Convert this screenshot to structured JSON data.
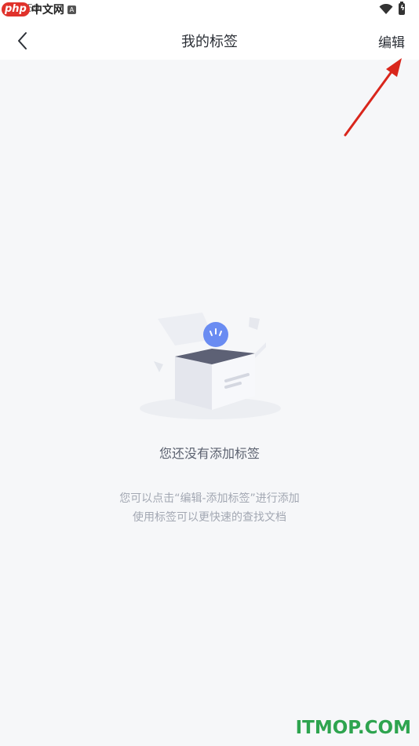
{
  "status_bar": {
    "time": ":59",
    "watermark_logo": "php",
    "watermark_text": "中文网",
    "notif_icon_letter": "A",
    "icons": [
      "wifi-icon",
      "battery-icon"
    ]
  },
  "navbar": {
    "back_icon": "chevron-left-icon",
    "title": "我的标签",
    "edit_label": "编辑"
  },
  "empty_state": {
    "illustration": "open-box-illustration",
    "title": "您还没有添加标签",
    "desc_line1": "您可以点击“编辑-添加标签”进行添加",
    "desc_line2": "使用标签可以更快速的查找文档"
  },
  "watermark": "ITMOP.COM",
  "colors": {
    "background": "#f6f7f9",
    "accent_blue": "#6a8cf2",
    "annotation_red": "#d9261c",
    "watermark_green": "#2ea44f"
  }
}
